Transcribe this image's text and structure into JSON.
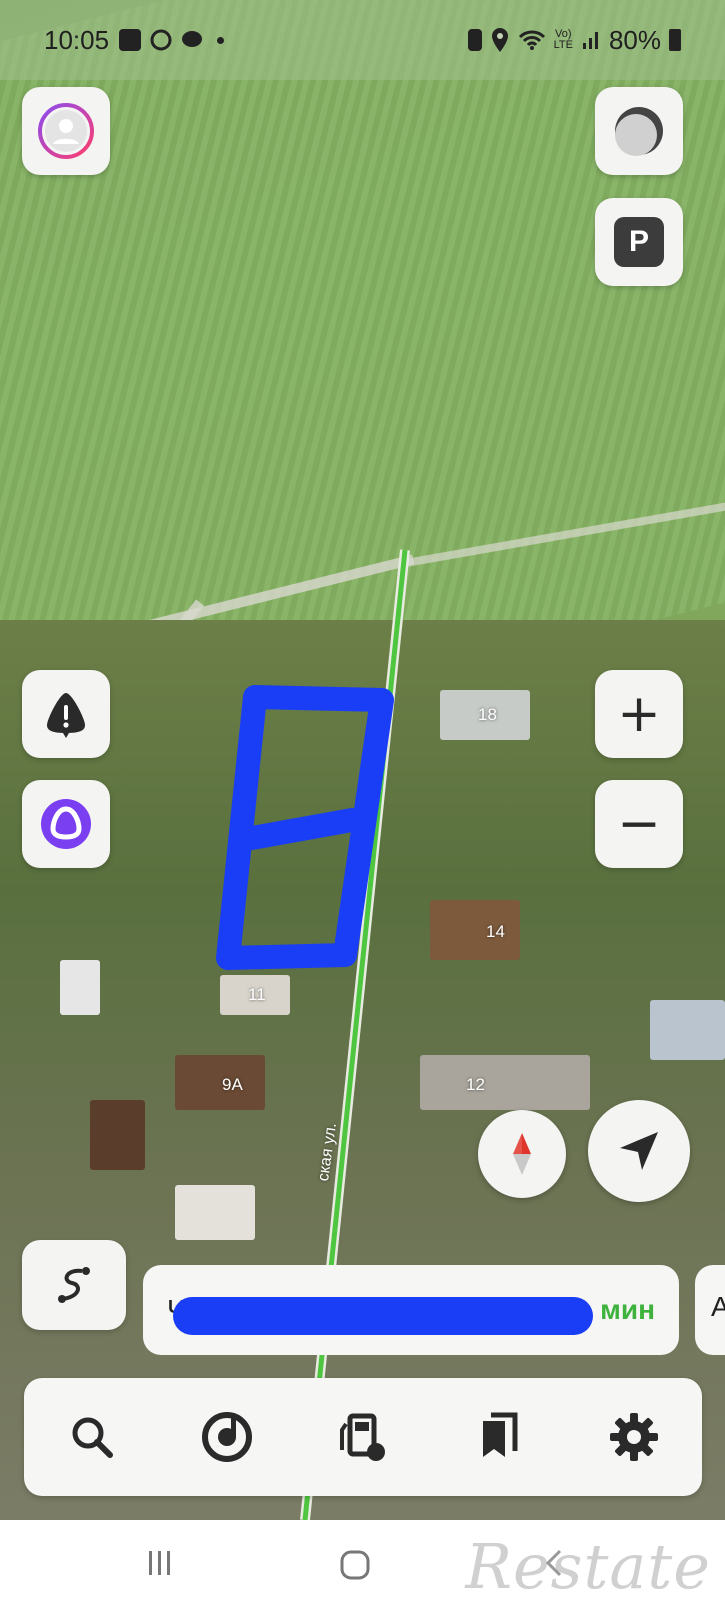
{
  "status_bar": {
    "time": "10:05",
    "battery": "80%",
    "left_icons": [
      "gallery-icon",
      "whatsapp-icon",
      "message-icon",
      "dot-icon"
    ],
    "right_icons": [
      "battery-saver-icon",
      "location-icon",
      "wifi-icon",
      "volte-icon",
      "signal-icon",
      "battery-icon"
    ]
  },
  "map": {
    "house_numbers": [
      "18",
      "14",
      "11",
      "9A",
      "12"
    ],
    "street_label": "ская ул."
  },
  "buttons": {
    "profile": "profile-icon",
    "layers": "layers-icon",
    "parking": "P",
    "alert": "alert-icon",
    "alice": "alice-icon",
    "zoom_in": "+",
    "zoom_out": "−",
    "compass": "compass-icon",
    "locate": "locate-icon",
    "route_options": "route-icon"
  },
  "route": {
    "destination_initial": "Ч",
    "time_label": "мин",
    "extra": "А"
  },
  "toolbar": {
    "items": [
      {
        "name": "search",
        "icon": "search-icon"
      },
      {
        "name": "music",
        "icon": "music-icon"
      },
      {
        "name": "fuel",
        "icon": "fuel-icon"
      },
      {
        "name": "bookmarks",
        "icon": "bookmarks-icon"
      },
      {
        "name": "settings",
        "icon": "gear-icon"
      }
    ]
  },
  "navbar": {
    "watermark": "Restate"
  },
  "colors": {
    "route_line": "#4fc640",
    "scribble": "#1a3ef5",
    "accent_red": "#e0352b",
    "alice_purple": "#7b3ff2"
  }
}
